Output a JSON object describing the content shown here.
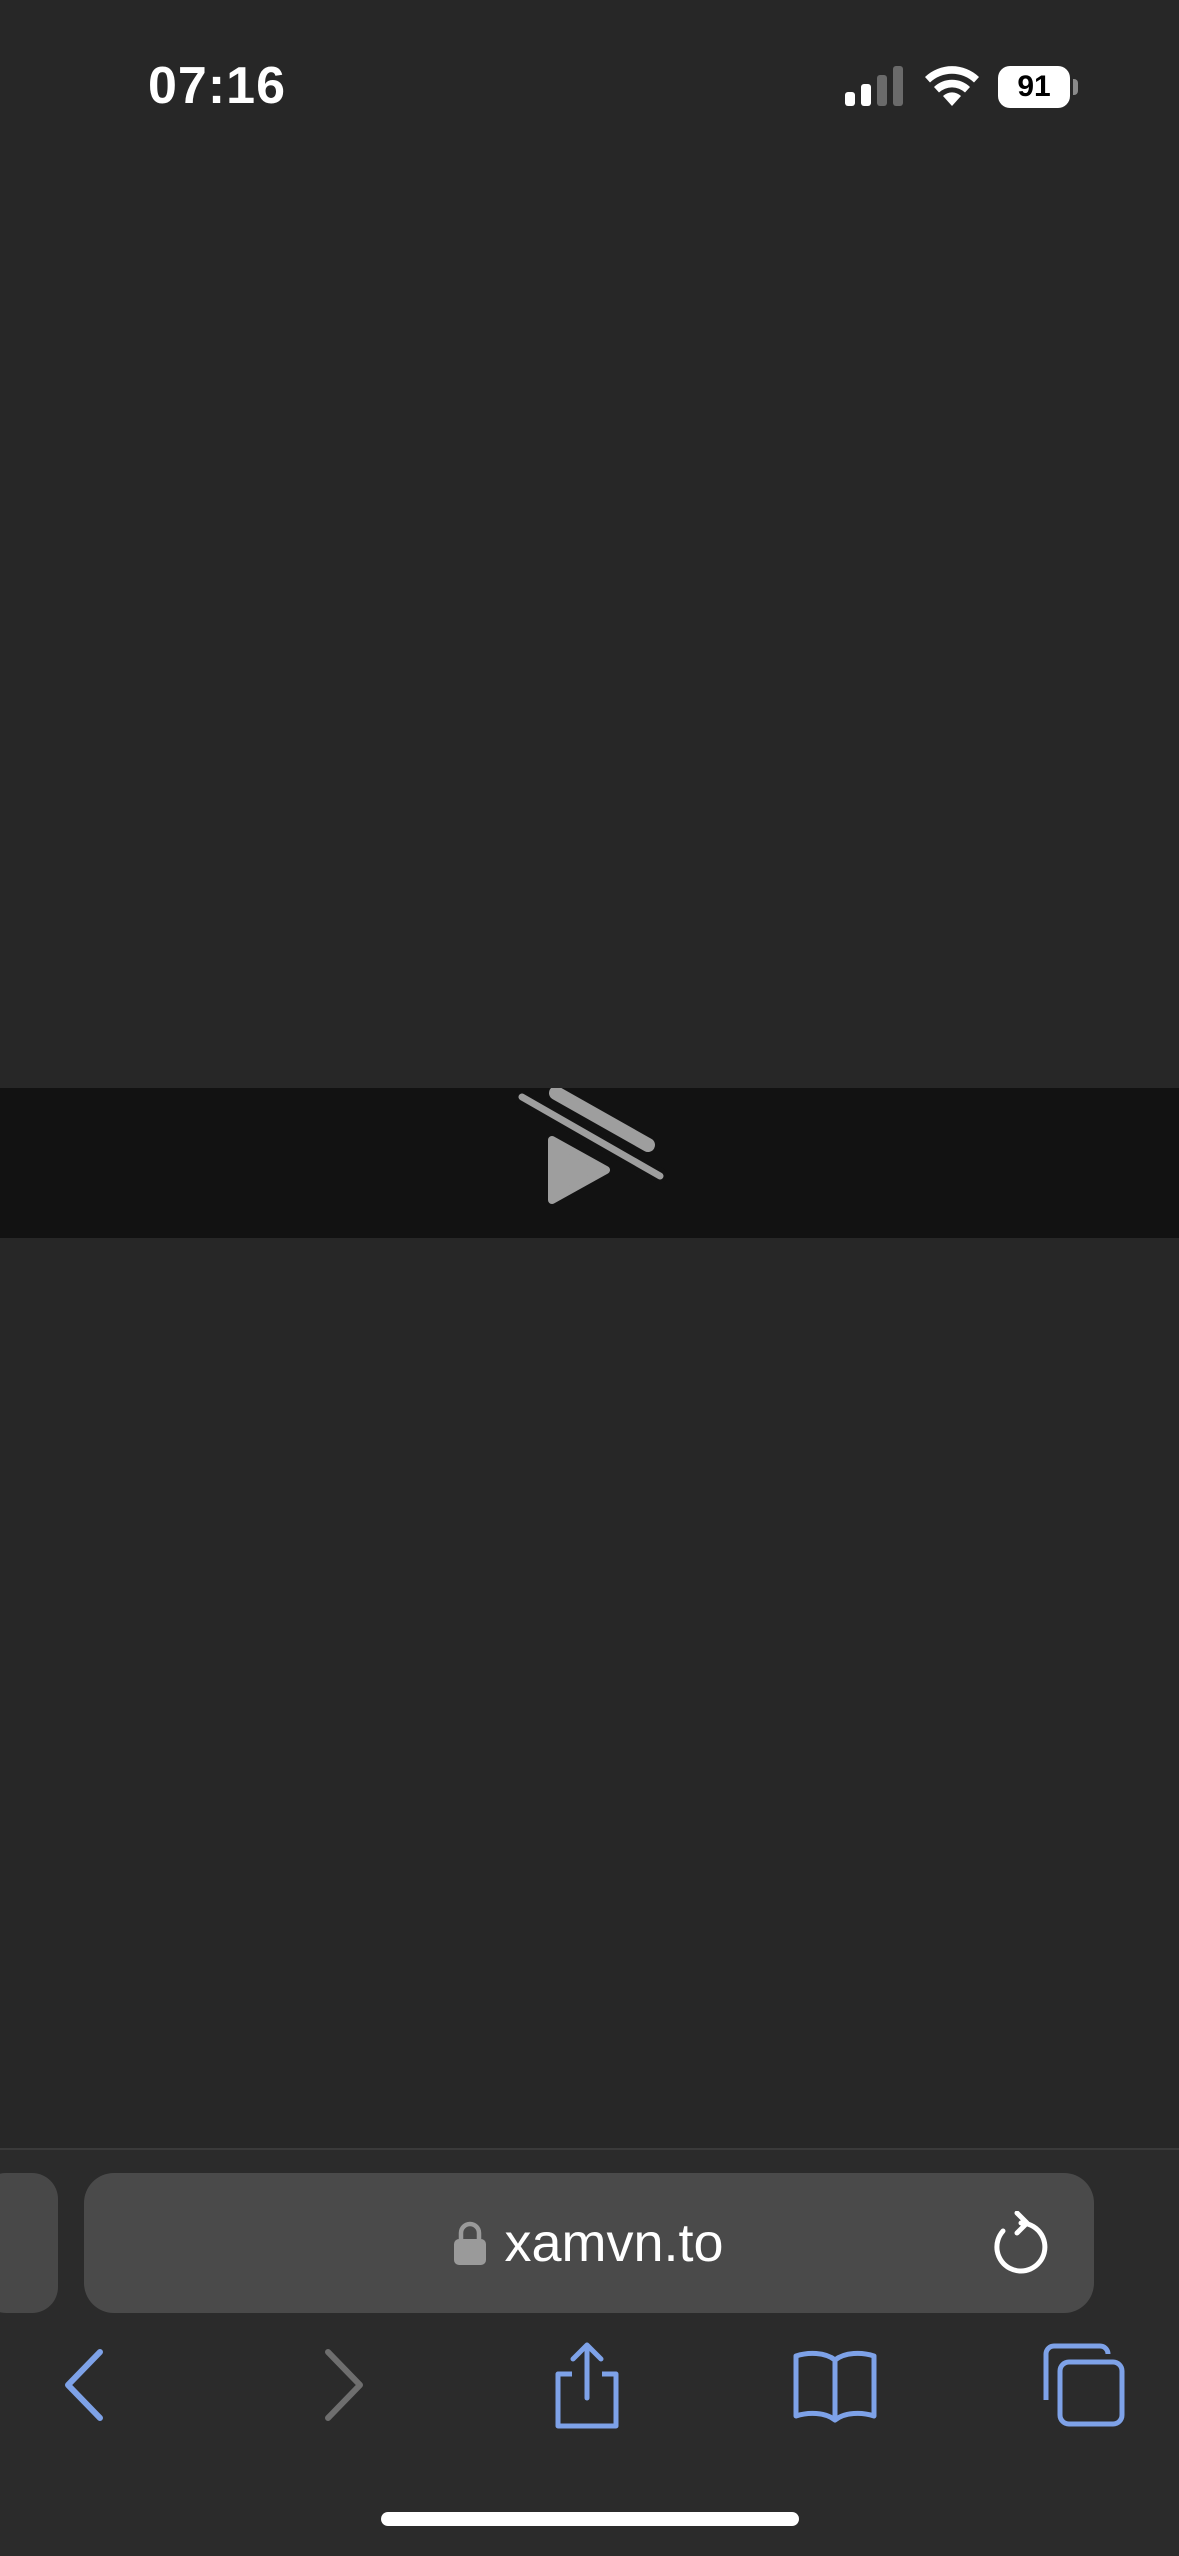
{
  "status_bar": {
    "time": "07:16",
    "battery_level": "91",
    "icons": [
      "cellular-signal-icon",
      "wifi-icon",
      "battery-icon"
    ]
  },
  "video": {
    "icon": "video-unavailable-icon"
  },
  "browser": {
    "address": "xamvn.to",
    "icons": [
      "lock-icon",
      "reload-icon"
    ],
    "toolbar": [
      "back-icon",
      "forward-icon",
      "share-icon",
      "bookmarks-icon",
      "tabs-icon"
    ]
  },
  "colors": {
    "background": "#272727",
    "video_strip": "#121212",
    "address_bar": "#4a4a4a",
    "accent": "#7ea2e8",
    "disabled": "#6e6e6e"
  }
}
